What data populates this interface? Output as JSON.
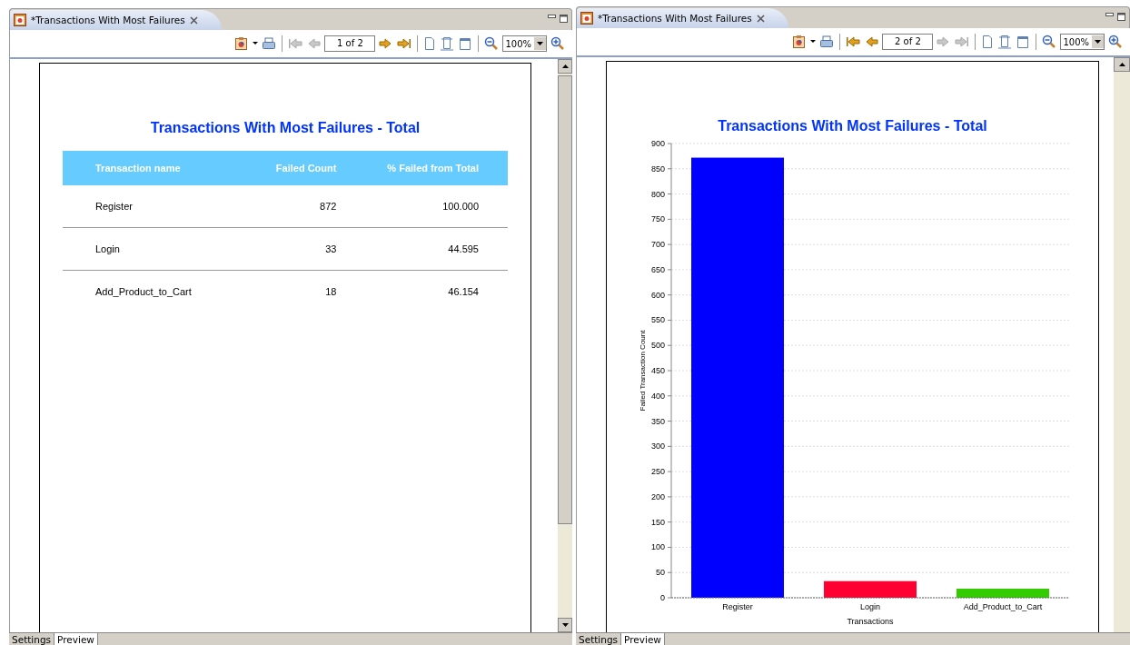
{
  "panes": [
    {
      "tab": {
        "title": "*Transactions With Most Failures"
      },
      "toolbar": {
        "page": "1 of 2",
        "zoom": "100%",
        "nav": [
          {
            "kind": "first",
            "disabled": true
          },
          {
            "kind": "prev",
            "disabled": true
          },
          {
            "kind": "next",
            "disabled": false
          },
          {
            "kind": "last",
            "disabled": false
          }
        ]
      },
      "report": {
        "kind": "table",
        "title": "Transactions With Most Failures - Total",
        "columns": [
          "Transaction name",
          "Failed Count",
          "% Failed from Total"
        ],
        "rows": [
          [
            "Register",
            "872",
            "100.000"
          ],
          [
            "Login",
            "33",
            "44.595"
          ],
          [
            "Add_Product_to_Cart",
            "18",
            "46.154"
          ]
        ]
      },
      "bottom_tabs": [
        {
          "label": "Settings",
          "selected": false
        },
        {
          "label": "Preview",
          "selected": true
        }
      ]
    },
    {
      "tab": {
        "title": "*Transactions With Most Failures"
      },
      "toolbar": {
        "page": "2 of 2",
        "zoom": "100%",
        "nav": [
          {
            "kind": "first",
            "disabled": false
          },
          {
            "kind": "prev",
            "disabled": false
          },
          {
            "kind": "next",
            "disabled": true
          },
          {
            "kind": "last",
            "disabled": true
          }
        ]
      },
      "report": {
        "kind": "chart",
        "title": "Transactions With Most Failures - Total",
        "chart_data": {
          "type": "bar",
          "grid": true,
          "xlabel": "Transactions",
          "ylabel": "Failed Transaction Count",
          "categories": [
            "Register",
            "Login",
            "Add_Product_to_Cart"
          ],
          "values": [
            872,
            33,
            18
          ],
          "colors": [
            "#0000ff",
            "#ff0033",
            "#33cc00"
          ],
          "ylim": [
            0,
            900
          ],
          "yticks": [
            0,
            50,
            100,
            150,
            200,
            250,
            300,
            350,
            400,
            450,
            500,
            550,
            600,
            650,
            700,
            750,
            800,
            850,
            900
          ]
        }
      },
      "bottom_tabs": [
        {
          "label": "Settings",
          "selected": false
        },
        {
          "label": "Preview",
          "selected": true
        }
      ]
    }
  ]
}
